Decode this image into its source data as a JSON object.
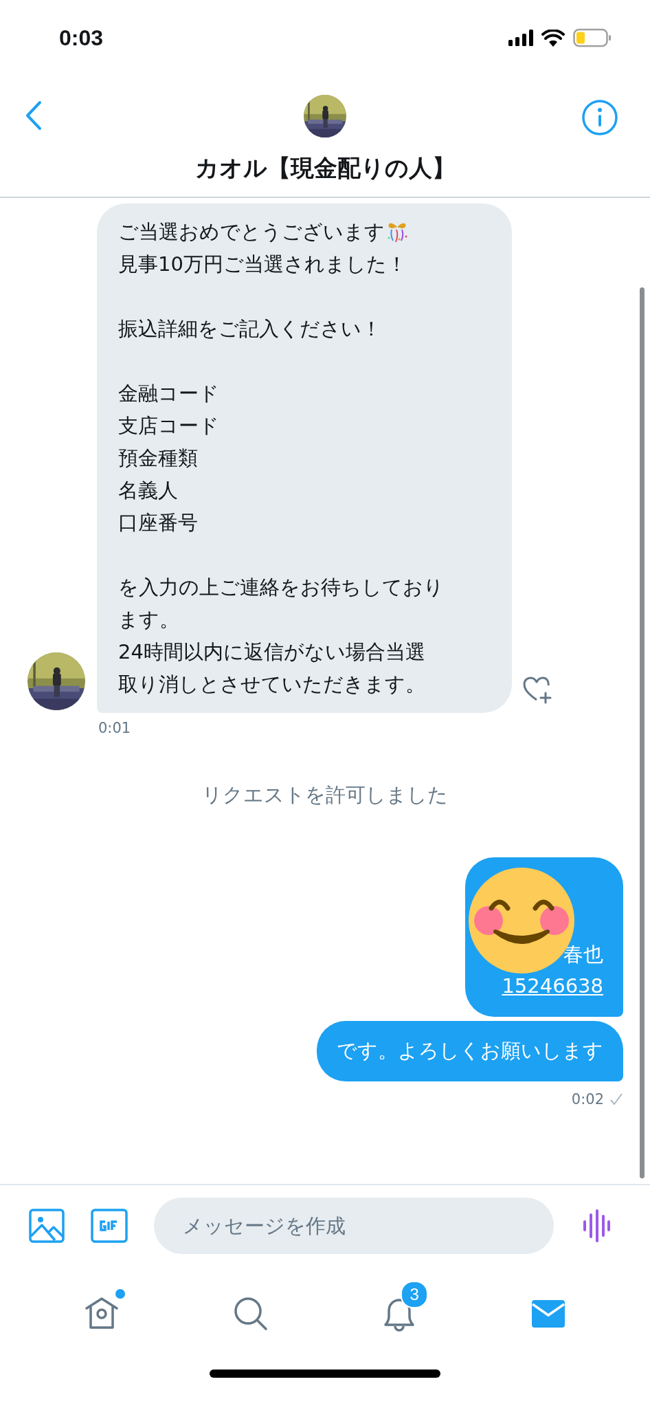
{
  "status_bar": {
    "time": "0:03"
  },
  "header": {
    "title": "カオル【現金配りの人】"
  },
  "incoming": {
    "paragraphs": [
      [
        {
          "text": "ご当選おめでとうございます",
          "kind": "emoji-after"
        },
        {
          "text": "見事10万円ご当選されました！",
          "kind": "plain"
        }
      ],
      [
        {
          "text": "振込詳細をご記入ください！",
          "kind": "plain"
        }
      ],
      [
        {
          "text": "金融コード",
          "kind": "plain"
        },
        {
          "text": "支店コード",
          "kind": "plain"
        },
        {
          "text": "預金種類",
          "kind": "plain"
        },
        {
          "text": "名義人",
          "kind": "plain"
        },
        {
          "text": "口座番号",
          "kind": "plain"
        }
      ],
      [
        {
          "text": "を入力の上ご連絡をお待ちしており",
          "kind": "plain"
        },
        {
          "text": "ます。",
          "kind": "plain"
        },
        {
          "text": "24時間以内に返信がない場合当選",
          "kind": "plain"
        },
        {
          "text": "取り消しとさせていただきます。",
          "kind": "plain"
        }
      ]
    ],
    "time": "0:01",
    "liked": false
  },
  "system_note": "リクエストを許可しました",
  "outgoing": [
    {
      "lines": [
        {
          "text": "春也",
          "kind": "plain"
        },
        {
          "text": "15246638",
          "kind": "link"
        }
      ],
      "sticker": true
    },
    {
      "lines": [
        {
          "text": "です。よろしくお願いします",
          "kind": "plain"
        }
      ],
      "sticker": false
    }
  ],
  "outgoing_time": "0:02",
  "read_receipt": true,
  "composer": {
    "placeholder": "メッセージを作成"
  },
  "tabs": [
    {
      "kind": "home",
      "selected": false,
      "dot": true
    },
    {
      "kind": "search",
      "selected": false,
      "dot": false
    },
    {
      "kind": "notifications",
      "selected": false,
      "dot": false,
      "badge": "3"
    },
    {
      "kind": "messages",
      "selected": true,
      "dot": false
    }
  ]
}
